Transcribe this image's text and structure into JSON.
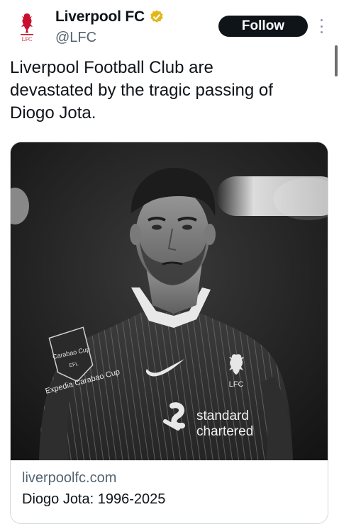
{
  "post": {
    "author": {
      "display_name": "Liverpool FC",
      "handle": "@LFC",
      "verified": true,
      "avatar_text": "LFC"
    },
    "follow_label": "Follow",
    "text": "Liverpool Football Club are\ndevastated by the tragic passing of\nDiogo Jota.",
    "media": {
      "kit_texts": {
        "cup_badge": "Carabao Cup",
        "cup_badge_efl": "EFL",
        "sleeve": "Expedia Carabao Cup",
        "crest_text": "LFC",
        "sponsor_line1": "standard",
        "sponsor_line2": "chartered"
      }
    },
    "link_card": {
      "domain": "liverpoolfc.com",
      "title": "Diogo Jota: 1996-2025"
    }
  },
  "colors": {
    "follow_bg": "#0f1419",
    "follow_text": "#ffffff",
    "verified_gold": "#e2b719",
    "crest_red": "#c8102e",
    "muted_text": "#536471"
  }
}
